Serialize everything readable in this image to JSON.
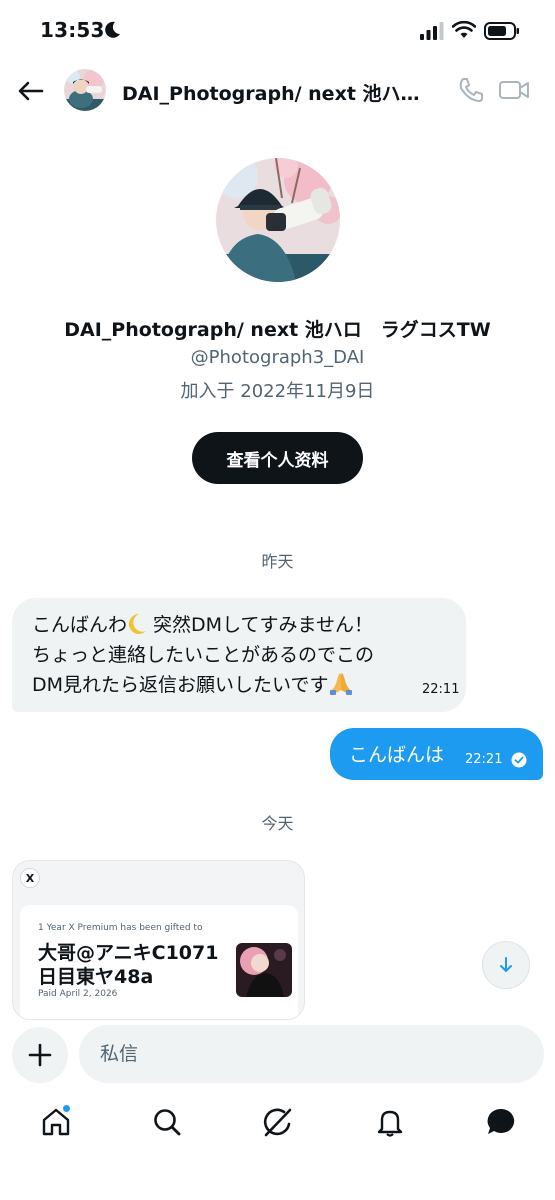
{
  "status_bar": {
    "time": "13:53"
  },
  "header": {
    "title": "DAI_Photograph/ next 池ハロ…"
  },
  "profile": {
    "name": "DAI_Photograph/ next 池ハロ　ラグコスTW",
    "handle": "@Photograph3_DAI",
    "joined": "加入于 2022年11月9日",
    "view_profile_label": "查看个人资料"
  },
  "conversation": {
    "date_yesterday": "昨天",
    "date_today": "今天",
    "incoming": {
      "line1_a": "こんばんわ",
      "line1_b": " 突然DMしてすみません！",
      "line2": "ちょっと連絡したいことがあるのでこの",
      "line3": "DM見れたら返信お願いしたいです",
      "time": "22:11"
    },
    "outgoing": {
      "text": "こんばんは",
      "time": "22:21"
    },
    "card": {
      "badge": "X",
      "gifted_line": "1 Year X Premium has been gifted to",
      "name_line1": "大哥@アニキC1071",
      "name_line2": "日目東ヤ48a",
      "paid_line": "Paid April 2, 2026"
    }
  },
  "composer": {
    "placeholder": "私信"
  },
  "tab_bar": {
    "items": [
      "home",
      "search",
      "grok",
      "notifications",
      "messages"
    ],
    "home_has_badge": true
  },
  "colors": {
    "accent": "#1d9bf0",
    "text": "#0f1419",
    "secondary": "#536471",
    "bubble_in": "#eff3f4"
  }
}
